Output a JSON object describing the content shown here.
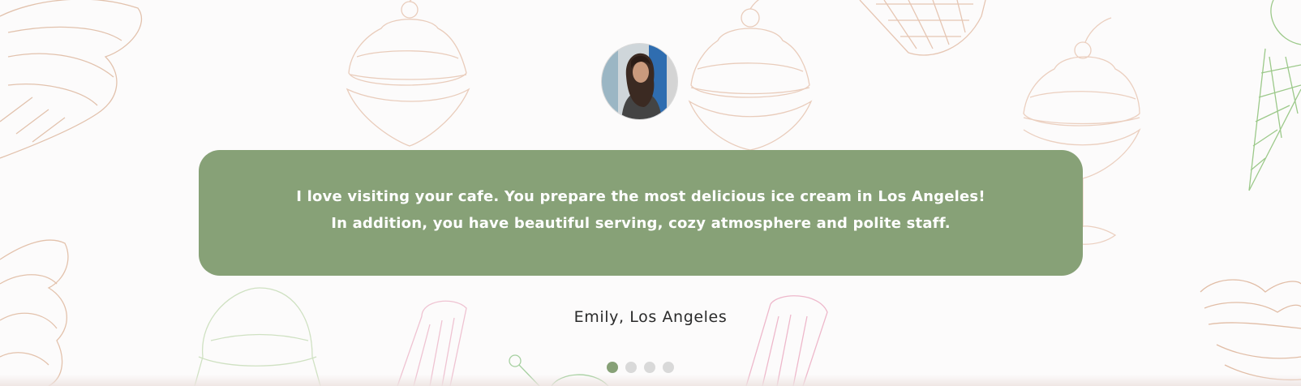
{
  "colors": {
    "card_background": "#87a177",
    "page_background": "#fcfbfb",
    "dot_active": "#87a177",
    "dot_inactive": "#d9d9d9"
  },
  "testimonial": {
    "avatar_icon": "customer-photo",
    "quote": "I love visiting your cafe. You prepare the most delicious ice cream in Los Angeles! In addition, you have beautiful serving, cozy atmosphere and polite staff.",
    "author": "Emily, Los Angeles"
  },
  "pagination": {
    "total": 4,
    "active_index": 0
  }
}
